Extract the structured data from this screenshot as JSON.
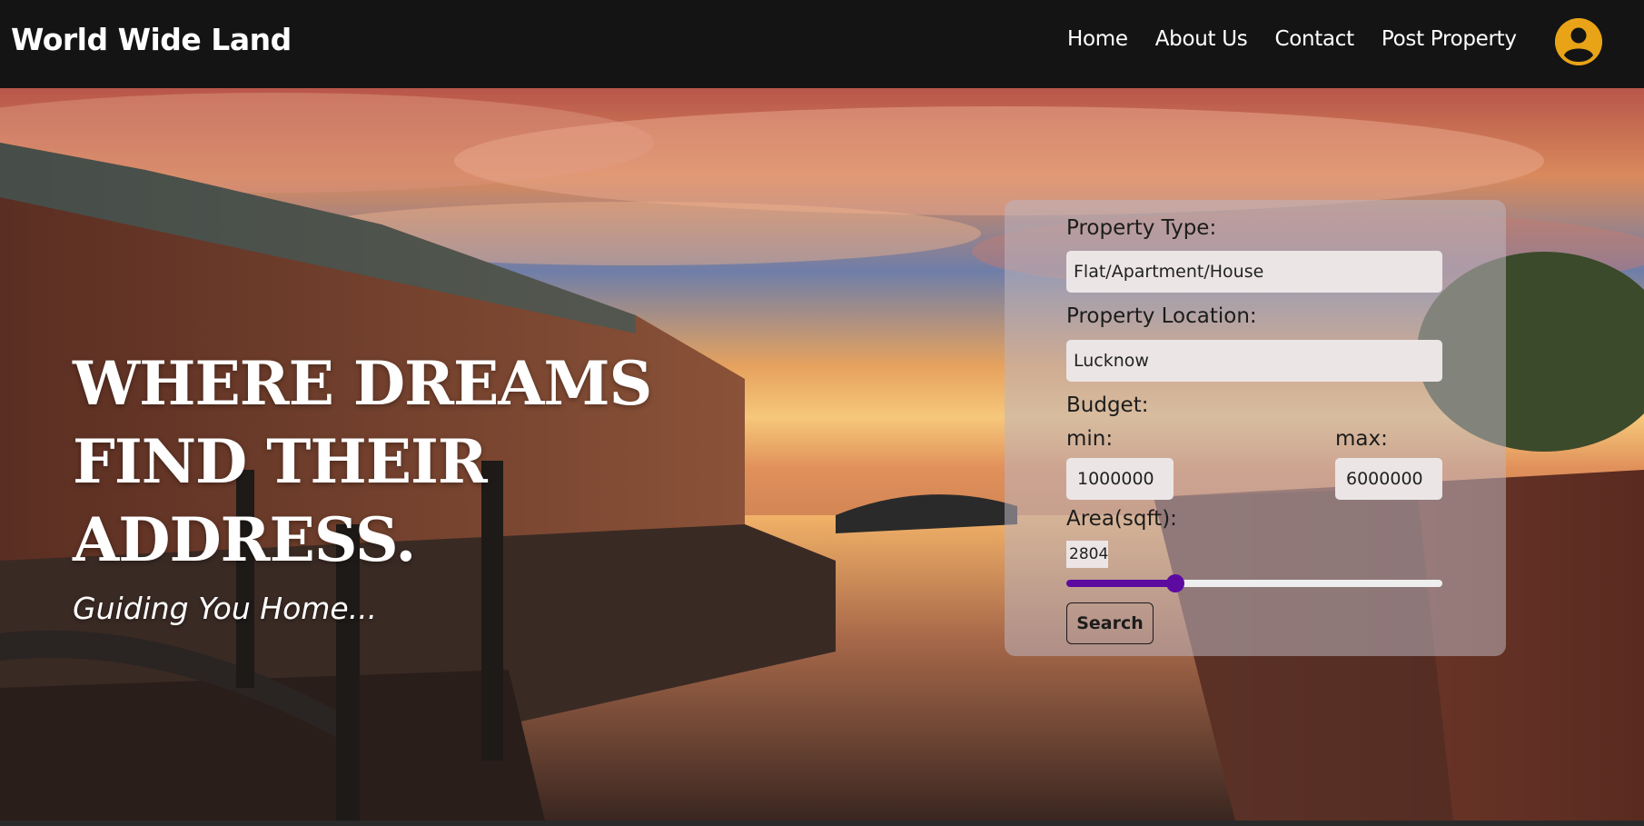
{
  "navbar": {
    "brand": "World Wide Land",
    "links": [
      "Home",
      "About Us",
      "Contact",
      "Post Property"
    ],
    "avatar_icon": "user-circle-icon",
    "avatar_color": "#e8a317"
  },
  "hero": {
    "headline_lines": [
      "WHERE DREAMS",
      "FIND THEIR",
      "ADDRESS."
    ],
    "tagline": "Guiding You Home..."
  },
  "search": {
    "property_type_label": "Property Type:",
    "property_type_value": "Flat/Apartment/House",
    "property_location_label": "Property Location:",
    "property_location_value": "Lucknow",
    "budget_label": "Budget:",
    "min_label": "min:",
    "min_value": "1000000",
    "max_label": "max:",
    "max_value": "6000000",
    "area_label": "Area(sqft):",
    "area_value": "2804",
    "area_fraction": 0.29,
    "search_label": "Search",
    "accent_color": "#5c0aa0"
  }
}
